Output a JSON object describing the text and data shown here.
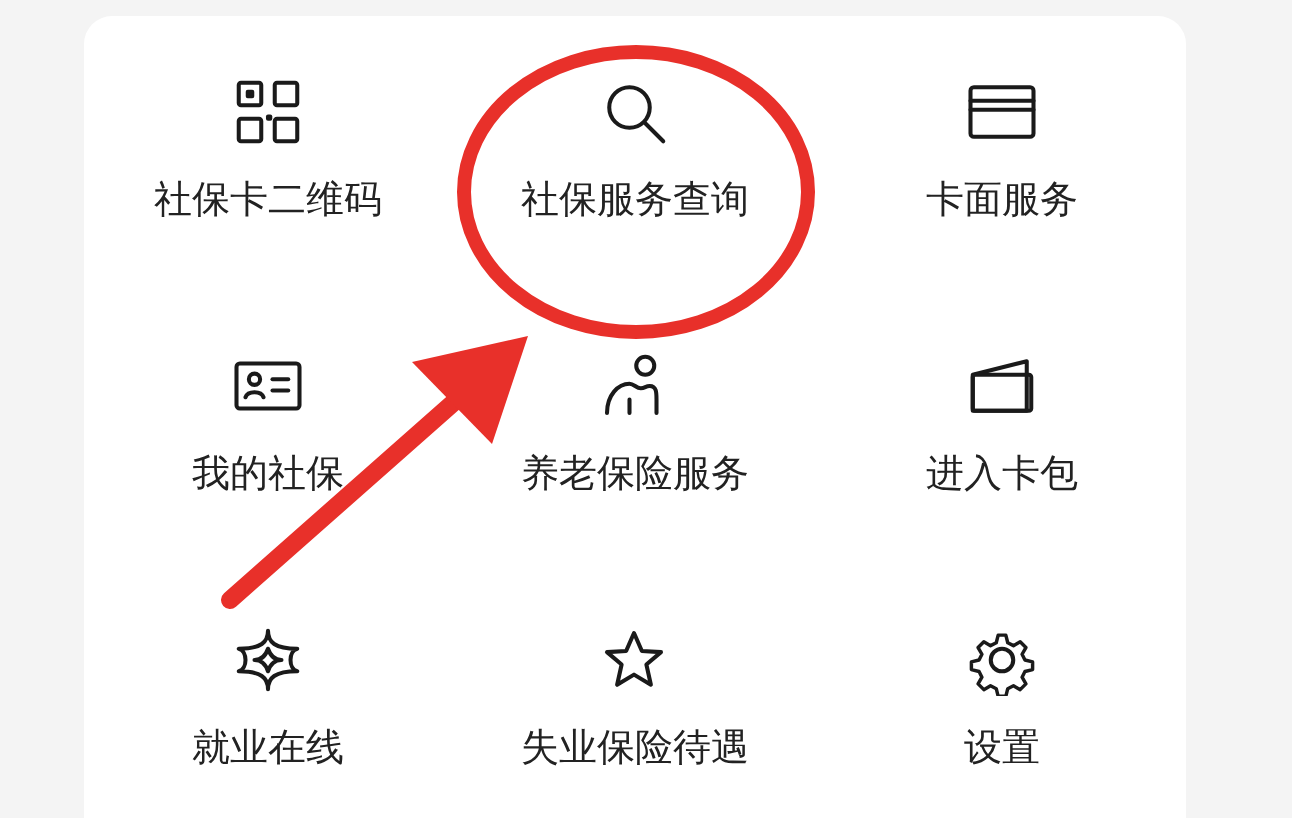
{
  "menu": {
    "items": [
      {
        "kind": "qr",
        "label": "社保卡二维码"
      },
      {
        "kind": "search",
        "label": "社保服务查询"
      },
      {
        "kind": "card",
        "label": "卡面服务"
      },
      {
        "kind": "idcard",
        "label": "我的社保"
      },
      {
        "kind": "person",
        "label": "养老保险服务"
      },
      {
        "kind": "wallet",
        "label": "进入卡包"
      },
      {
        "kind": "job",
        "label": "就业在线"
      },
      {
        "kind": "star",
        "label": "失业保险待遇"
      },
      {
        "kind": "gear",
        "label": "设置"
      }
    ]
  }
}
